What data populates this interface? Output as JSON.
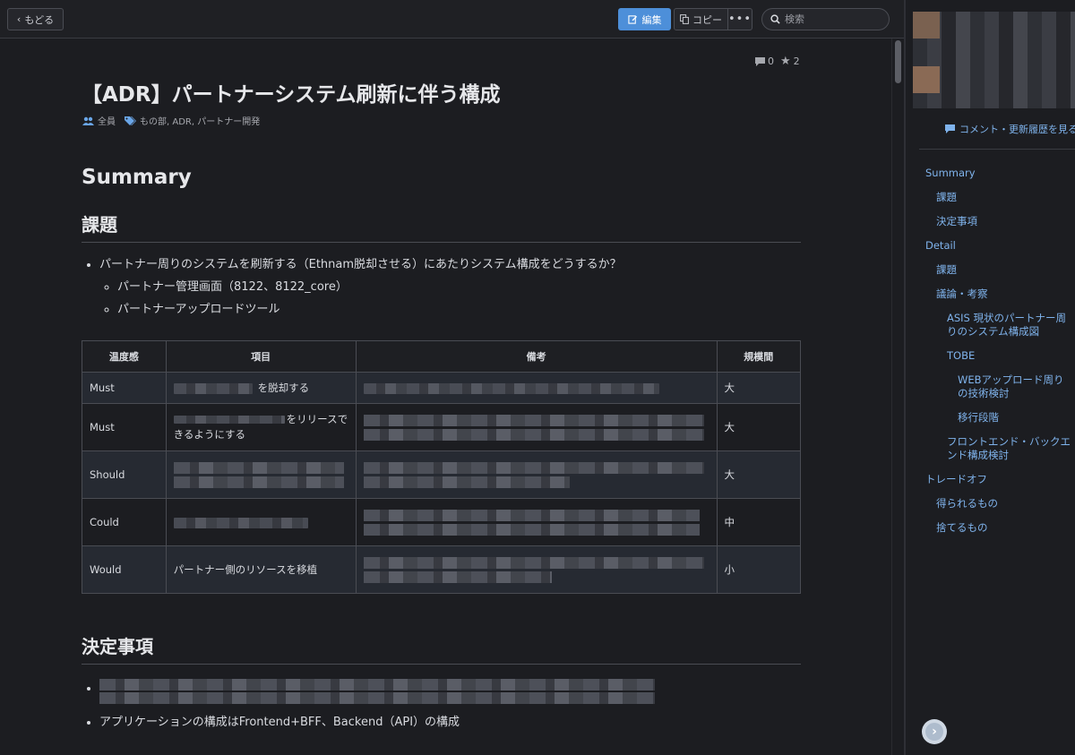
{
  "toolbar": {
    "back_label": "もどる",
    "edit_label": "編集",
    "copy_label": "コピー",
    "more_label": "•••",
    "search_placeholder": "検索"
  },
  "post": {
    "comments": "0",
    "stars": "2",
    "title": "【ADR】パートナーシステム刷新に伴う構成",
    "audience": "全員",
    "tags": "もの部, ADR, パートナー開発"
  },
  "content": {
    "summary_heading": "Summary",
    "issue_heading": "課題",
    "issue_items": [
      "パートナー周りのシステムを刷新する（Ethnam脱却させる）にあたりシステム構成をどうするか？"
    ],
    "issue_sub_items": [
      "パートナー管理画面（8122、8122_core）",
      "パートナーアップロードツール"
    ],
    "table": {
      "headers": [
        "温度感",
        "項目",
        "備考",
        "規模間"
      ],
      "rows": [
        {
          "priority": "Must",
          "item": "を脱却する",
          "size": "大"
        },
        {
          "priority": "Must",
          "item": "をリリースできるようにする",
          "size": "大"
        },
        {
          "priority": "Should",
          "item": "",
          "size": "大"
        },
        {
          "priority": "Could",
          "item": "",
          "size": "中"
        },
        {
          "priority": "Would",
          "item": "パートナー側のリソースを移植",
          "size": "小"
        }
      ]
    },
    "decision_heading": "決定事項",
    "decision_items": [
      "アプリケーションの構成はFrontend+BFF、Backend（API）の構成"
    ]
  },
  "sidebar": {
    "history_label": "コメント・更新履歴を見る",
    "toc": [
      {
        "label": "Summary",
        "level": 0
      },
      {
        "label": "課題",
        "level": 1
      },
      {
        "label": "決定事項",
        "level": 1
      },
      {
        "label": "Detail",
        "level": 0
      },
      {
        "label": "課題",
        "level": 1
      },
      {
        "label": "議論・考察",
        "level": 1
      },
      {
        "label": "ASIS 現状のパートナー周りのシステム構成図",
        "level": 2
      },
      {
        "label": "TOBE",
        "level": 2
      },
      {
        "label": "WEBアップロード周りの技術検討",
        "level": 3
      },
      {
        "label": "移行段階",
        "level": 3
      },
      {
        "label": "フロントエンド・バックエンド構成検討",
        "level": 2
      },
      {
        "label": "トレードオフ",
        "level": 0
      },
      {
        "label": "得られるもの",
        "level": 1
      },
      {
        "label": "捨てるもの",
        "level": 1
      }
    ]
  },
  "colors": {
    "accent": "#4d8fd9",
    "link": "#7fb3ec",
    "background": "#1c1d21"
  }
}
